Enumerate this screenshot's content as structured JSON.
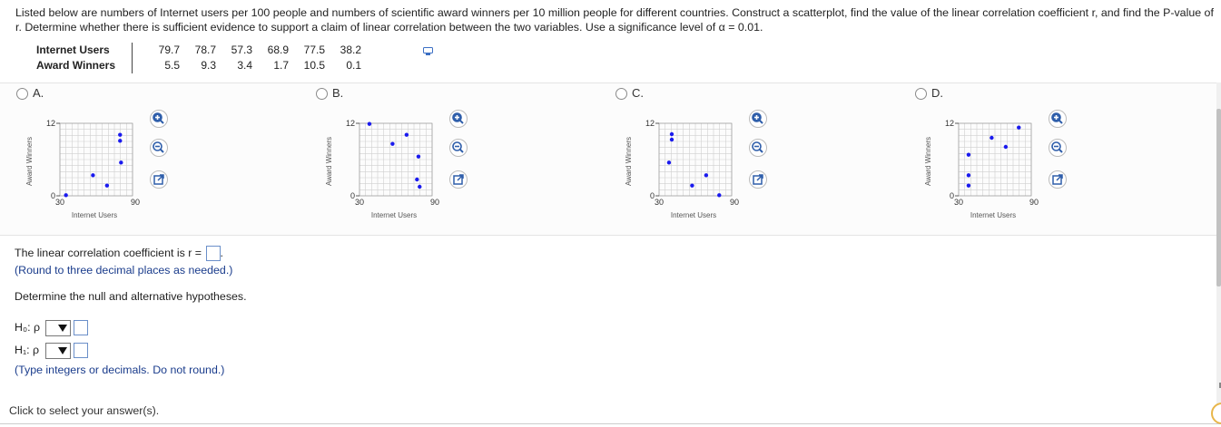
{
  "question": "Listed below are numbers of Internet users per 100 people and numbers of scientific award winners per 10 million people for different countries. Construct a scatterplot, find the value of the linear correlation coefficient r, and find the P-value of r. Determine whether there is sufficient evidence to support a claim of linear correlation between the two variables. Use a significance level of α = 0.01.",
  "table": {
    "row1_label": "Internet Users",
    "row1_values": [
      "79.7",
      "78.7",
      "57.3",
      "68.9",
      "77.5",
      "38.2"
    ],
    "row2_label": "Award Winners",
    "row2_values": [
      "5.5",
      "9.3",
      "3.4",
      "1.7",
      "10.5",
      "0.1"
    ]
  },
  "options": [
    {
      "label": "A.",
      "ylabel": "Award Winners",
      "xlabel": "Internet Users",
      "ytick_top": "12",
      "ytick_bottom": "0",
      "xtick_left": "30",
      "xtick_right": "90"
    },
    {
      "label": "B.",
      "ylabel": "Award Winners",
      "xlabel": "Internet Users",
      "ytick_top": "12",
      "ytick_bottom": "0",
      "xtick_left": "30",
      "xtick_right": "90"
    },
    {
      "label": "C.",
      "ylabel": "Award Winners",
      "xlabel": "Internet Users",
      "ytick_top": "12",
      "ytick_bottom": "0",
      "xtick_left": "30",
      "xtick_right": "90"
    },
    {
      "label": "D.",
      "ylabel": "Award Winners",
      "xlabel": "Internet Users",
      "ytick_top": "12",
      "ytick_bottom": "0",
      "xtick_left": "30",
      "xtick_right": "90"
    }
  ],
  "chart_data": [
    {
      "type": "scatter",
      "option": "A",
      "xlim": [
        30,
        90
      ],
      "ylim": [
        0,
        12
      ],
      "xlabel": "Internet Users",
      "ylabel": "Award Winners",
      "points": [
        [
          79.7,
          10.1
        ],
        [
          79.7,
          9.1
        ],
        [
          57.3,
          3.4
        ],
        [
          68.9,
          1.7
        ],
        [
          80.5,
          5.5
        ],
        [
          35,
          0.1
        ]
      ]
    },
    {
      "type": "scatter",
      "option": "B",
      "xlim": [
        30,
        90
      ],
      "ylim": [
        0,
        12
      ],
      "xlabel": "Internet Users",
      "ylabel": "Award Winners",
      "points": [
        [
          38.2,
          11.9
        ],
        [
          57.3,
          8.6
        ],
        [
          68.9,
          10.1
        ],
        [
          78.7,
          6.5
        ],
        [
          77.5,
          2.7
        ],
        [
          79.7,
          1.5
        ]
      ]
    },
    {
      "type": "scatter",
      "option": "C",
      "xlim": [
        30,
        90
      ],
      "ylim": [
        0,
        12
      ],
      "xlabel": "Internet Users",
      "ylabel": "Award Winners",
      "points": [
        [
          40.5,
          10.2
        ],
        [
          40.5,
          9.3
        ],
        [
          38.2,
          5.5
        ],
        [
          68.9,
          3.4
        ],
        [
          57.3,
          1.7
        ],
        [
          79.7,
          0.1
        ]
      ]
    },
    {
      "type": "scatter",
      "option": "D",
      "xlim": [
        30,
        90
      ],
      "ylim": [
        0,
        12
      ],
      "xlabel": "Internet Users",
      "ylabel": "Award Winners",
      "points": [
        [
          79.7,
          11.3
        ],
        [
          57.3,
          9.6
        ],
        [
          68.9,
          8.1
        ],
        [
          38.2,
          6.8
        ],
        [
          38.2,
          3.4
        ],
        [
          38.2,
          1.7
        ]
      ]
    }
  ],
  "answer": {
    "r_prompt": "The linear correlation coefficient is r =",
    "r_hint": "(Round to three decimal places as needed.)",
    "hyp_prompt": "Determine the null and alternative hypotheses.",
    "h0_label": "H₀: ρ",
    "h1_label": "H₁: ρ",
    "hyp_hint": "(Type integers or decimals. Do not round.)"
  },
  "footer": "Click to select your answer(s).",
  "colors": {
    "point": "#1a1aee",
    "grid": "#cfcfcf",
    "hint": "#1a3c8c"
  }
}
